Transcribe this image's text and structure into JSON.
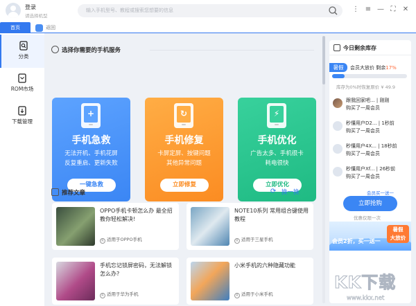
{
  "header": {
    "login": "登录",
    "login_sub": "请选择机型",
    "search_placeholder": "输入手机型号、教程或搜索您想要的信息"
  },
  "tabs": {
    "home": "首页",
    "back": "返回"
  },
  "sidebar": {
    "items": [
      {
        "label": "分类",
        "icon": "category-search-icon"
      },
      {
        "label": "ROM市场",
        "icon": "rom-market-icon"
      },
      {
        "label": "下载管理",
        "icon": "download-manager-icon"
      }
    ]
  },
  "services": {
    "title": "选择你需要的手机服务",
    "cards": [
      {
        "title": "手机急救",
        "line1": "无法开机、手机花屏",
        "line2": "反复重启、更新失败",
        "button": "一键急救",
        "color": "#3b86f4"
      },
      {
        "title": "手机修复",
        "line1": "卡屏定屏、按键问题",
        "line2": "其他异常问题",
        "button": "立即修复",
        "color": "#fb8c22"
      },
      {
        "title": "手机优化",
        "line1": "广告太多、手机很卡",
        "line2": "耗电很快",
        "button": "立即优化",
        "color": "#1fba83"
      }
    ]
  },
  "articles": {
    "title": "推荐文章",
    "refresh_label": "换一换",
    "items": [
      {
        "title": "OPPO手机卡顿怎么办 最全招教你轻松解决!",
        "tag": "适用于OPPO手机"
      },
      {
        "title": "NOTE10系列 常用组合键使用教程",
        "tag": "适用于三星手机"
      },
      {
        "title": "手机忘记锁屏密码，无法解锁怎么办?",
        "tag": "适用于华为手机"
      },
      {
        "title": "小米手机的六种隐藏功能",
        "tag": "适用于小米手机"
      }
    ]
  },
  "stock": {
    "title": "今日剩余库存",
    "badge": "暑假",
    "member_label": "会员大放价",
    "remaining_label": "剩余",
    "percent": "17%",
    "progress_fraction": 0.17,
    "progress_text": "库存为0%时恢复原价 ¥ 49.9",
    "feed": [
      {
        "l1": "跟我回家吧... | 刚刚",
        "l2": "购买了一周会员"
      },
      {
        "l1": "秒懂用户D2... | 1秒前",
        "l2": "购买了一周会员"
      },
      {
        "l1": "秒懂用户4X... | 18秒前",
        "l2": "购买了一周会员"
      },
      {
        "l1": "秒懂用户Xf... | 26秒前",
        "l2": "购买了一周会员"
      }
    ],
    "promo_top": "会员买一送一",
    "buy_button": "立即抢购",
    "promo_sub": "优惠仅限一次",
    "banner_text": "会员2折，买一送一",
    "banner_badge1": "暑假",
    "banner_badge2": "大放价"
  },
  "watermark": {
    "big": "KK下载",
    "url": "www.kkx.net"
  }
}
